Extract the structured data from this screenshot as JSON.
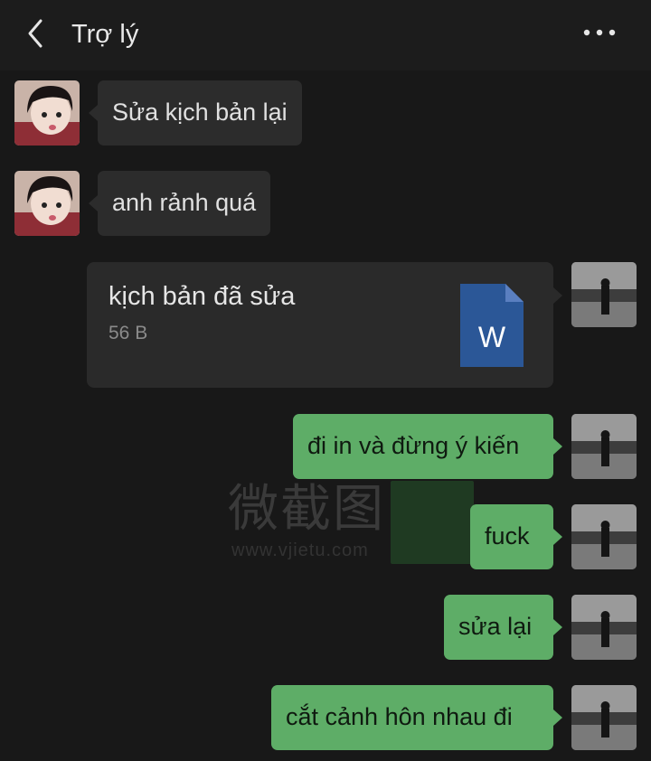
{
  "header": {
    "title": "Trợ lý"
  },
  "messages": [
    {
      "id": "m1",
      "side": "in",
      "text": "Sửa kịch bản lại"
    },
    {
      "id": "m2",
      "side": "in",
      "text": "anh rảnh quá"
    },
    {
      "id": "m3",
      "side": "out",
      "type": "file",
      "file_name": "kịch bản đã sửa",
      "file_size": "56 B",
      "file_icon_letter": "W"
    },
    {
      "id": "m4",
      "side": "out",
      "text": "đi in và đừng ý kiến"
    },
    {
      "id": "m5",
      "side": "out",
      "text": "fuck"
    },
    {
      "id": "m6",
      "side": "out",
      "text": "sửa lại"
    },
    {
      "id": "m7",
      "side": "out",
      "text": "cắt cảnh hôn nhau đi"
    }
  ],
  "watermark": {
    "text": "微截图",
    "url": "www.vjietu.com"
  },
  "colors": {
    "background": "#181818",
    "incoming_bubble": "#2c2c2c",
    "outgoing_bubble": "#5ead67",
    "word_icon": "#2b5797"
  },
  "icons": [
    "back-arrow-icon",
    "more-dots-icon",
    "word-document-icon"
  ]
}
